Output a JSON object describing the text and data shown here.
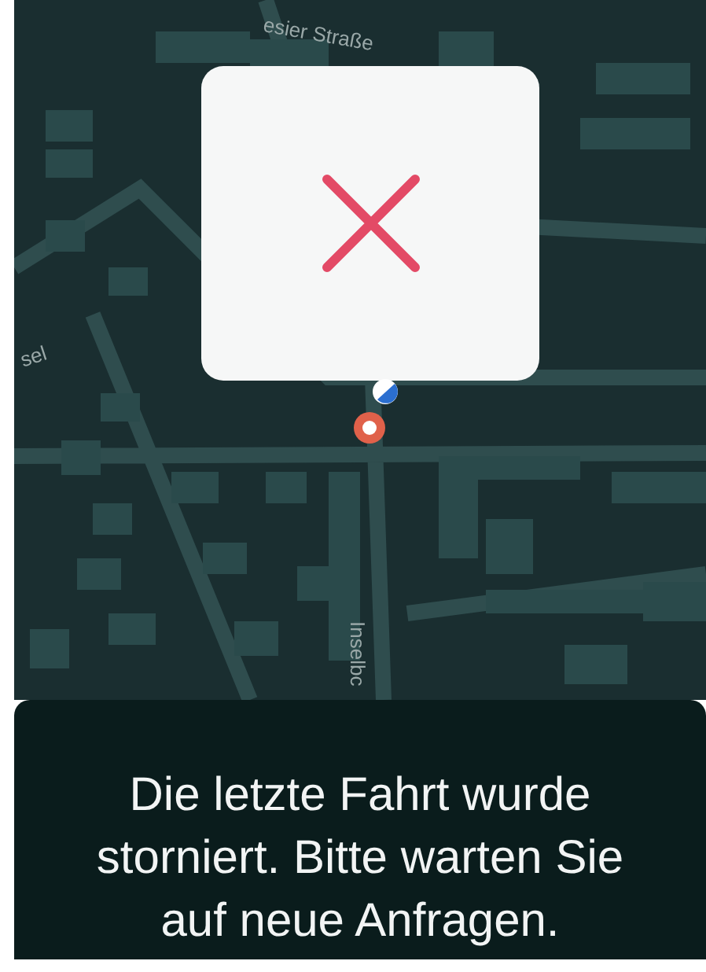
{
  "map": {
    "street_labels": [
      {
        "text": "esier Straße"
      },
      {
        "text": "sel"
      },
      {
        "text": "Inselbc"
      }
    ]
  },
  "popup": {
    "cancelled": true
  },
  "message": {
    "text": "Die letzte Fahrt wurde storniert. Bitte warten Sie auf neue Anfragen."
  }
}
